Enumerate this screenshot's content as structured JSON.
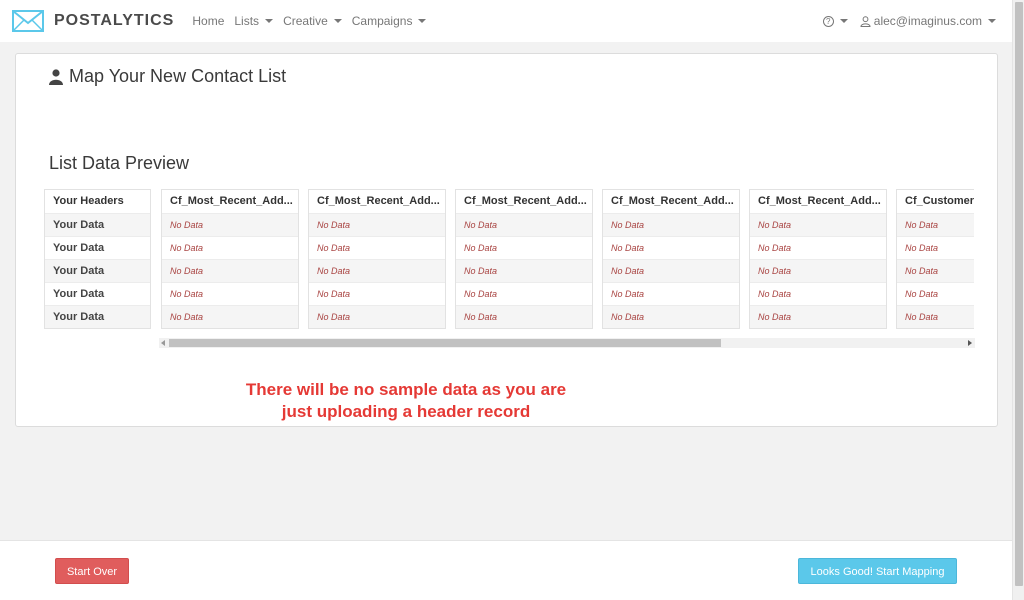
{
  "navbar": {
    "brand": "POSTALYTICS",
    "links": [
      {
        "label": "Home",
        "dropdown": false
      },
      {
        "label": "Lists",
        "dropdown": true
      },
      {
        "label": "Creative",
        "dropdown": true
      },
      {
        "label": "Campaigns",
        "dropdown": true
      }
    ],
    "help_glyph": "?",
    "user_email": "alec@imaginus.com"
  },
  "page": {
    "title": "Map Your New Contact List",
    "section_title": "List Data Preview"
  },
  "table": {
    "row_label_header": "Your Headers",
    "row_labels": [
      "Your Data",
      "Your Data",
      "Your Data",
      "Your Data",
      "Your Data"
    ],
    "columns": [
      {
        "header": "Cf_Most_Recent_Add...",
        "cells": [
          "No Data",
          "No Data",
          "No Data",
          "No Data",
          "No Data"
        ]
      },
      {
        "header": "Cf_Most_Recent_Add...",
        "cells": [
          "No Data",
          "No Data",
          "No Data",
          "No Data",
          "No Data"
        ]
      },
      {
        "header": "Cf_Most_Recent_Add...",
        "cells": [
          "No Data",
          "No Data",
          "No Data",
          "No Data",
          "No Data"
        ]
      },
      {
        "header": "Cf_Most_Recent_Add...",
        "cells": [
          "No Data",
          "No Data",
          "No Data",
          "No Data",
          "No Data"
        ]
      },
      {
        "header": "Cf_Most_Recent_Add...",
        "cells": [
          "No Data",
          "No Data",
          "No Data",
          "No Data",
          "No Data"
        ]
      },
      {
        "header": "Cf_Customer_",
        "cells": [
          "No Data",
          "No Data",
          "No Data",
          "No Data",
          "No Data"
        ]
      }
    ]
  },
  "annotation": {
    "line1": "There will be no sample data as you are",
    "line2": "just uploading a header record"
  },
  "footer": {
    "start_over": "Start Over",
    "start_mapping": "Looks Good! Start Mapping"
  },
  "colors": {
    "danger": "#e05d5d",
    "info": "#5bc8ea",
    "no_data": "#a94442",
    "annotation": "#e53935",
    "brand_icon": "#5bc8ea"
  },
  "icons": {
    "brand": "envelope-icon",
    "title": "user-icon",
    "user": "user-outline-icon",
    "help": "question-circle-icon"
  }
}
